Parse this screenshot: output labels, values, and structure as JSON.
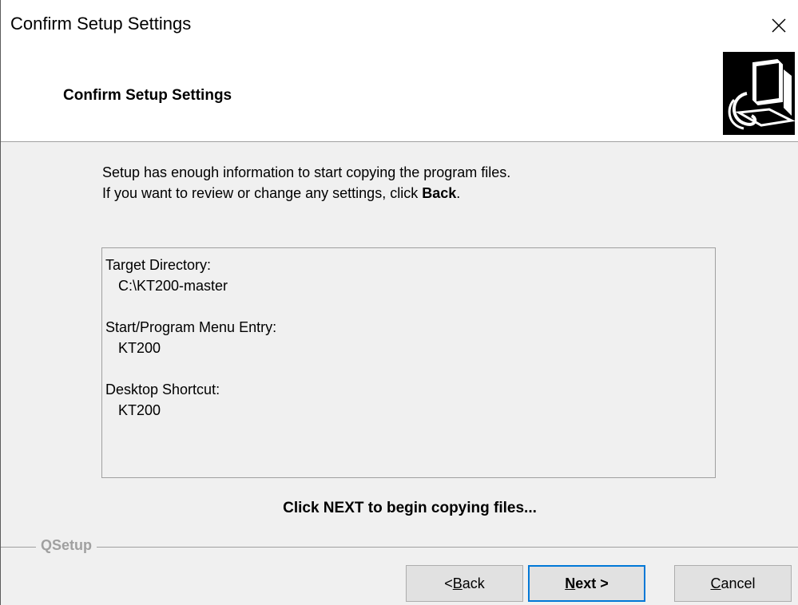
{
  "window": {
    "title": "Confirm Setup Settings"
  },
  "header": {
    "title": "Confirm Setup Settings"
  },
  "intro": {
    "line1": "Setup has enough information to start copying the program files.",
    "line2_prefix": "If you want to review or change any settings, click ",
    "line2_bold": "Back",
    "line2_suffix": "."
  },
  "settings": {
    "target_label": "Target Directory:",
    "target_value": "C:\\KT200-master",
    "menu_label": "Start/Program Menu Entry:",
    "menu_value": "KT200",
    "shortcut_label": "Desktop Shortcut:",
    "shortcut_value": "KT200"
  },
  "cta": "Click NEXT to begin copying files...",
  "brand": "QSetup",
  "buttons": {
    "back_prefix": "< ",
    "back_accel": "B",
    "back_rest": "ack",
    "next_accel": "N",
    "next_rest": "ext >",
    "cancel_accel": "C",
    "cancel_rest": "ancel"
  },
  "icons": {
    "close": "close-icon",
    "logo": "computer-setup-icon"
  },
  "colors": {
    "focus_border": "#0078d7",
    "dialog_bg": "#f0f0f0",
    "header_bg": "#ffffff"
  }
}
